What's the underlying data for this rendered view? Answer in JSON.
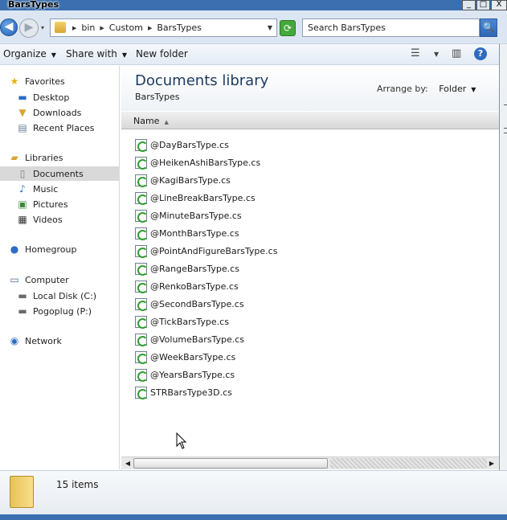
{
  "window": {
    "title": "BarsTypes",
    "minimize": "_",
    "maximize": "□",
    "close": "X"
  },
  "navigation": {
    "back": "◀",
    "forward": "▶",
    "history": "▾",
    "breadcrumb": [
      "bin",
      "Custom",
      "BarsTypes"
    ],
    "refresh": "⟳",
    "search_placeholder": "Search BarsTypes",
    "search_icon": "🔍"
  },
  "toolbar": {
    "organize": "Organize",
    "share_with": "Share with",
    "new_folder": "New folder",
    "view_icon": "☰",
    "preview_icon": "▥",
    "help_icon": "?"
  },
  "sidebar": {
    "favorites": {
      "label": "Favorites",
      "items": [
        "Desktop",
        "Downloads",
        "Recent Places"
      ]
    },
    "libraries": {
      "label": "Libraries",
      "items": [
        "Documents",
        "Music",
        "Pictures",
        "Videos"
      ]
    },
    "homegroup": {
      "label": "Homegroup"
    },
    "computer": {
      "label": "Computer",
      "items": [
        "Local Disk (C:)",
        "Pogoplug (P:)"
      ]
    },
    "network": {
      "label": "Network"
    }
  },
  "content": {
    "library_title": "Documents library",
    "library_subtitle": "BarsTypes",
    "arrange_label": "Arrange by:",
    "arrange_value": "Folder",
    "column_name": "Name",
    "files": [
      "@DayBarsType.cs",
      "@HeikenAshiBarsType.cs",
      "@KagiBarsType.cs",
      "@LineBreakBarsType.cs",
      "@MinuteBarsType.cs",
      "@MonthBarsType.cs",
      "@PointAndFigureBarsType.cs",
      "@RangeBarsType.cs",
      "@RenkoBarsType.cs",
      "@SecondBarsType.cs",
      "@TickBarsType.cs",
      "@VolumeBarsType.cs",
      "@WeekBarsType.cs",
      "@YearsBarsType.cs",
      "STRBarsType3D.cs"
    ]
  },
  "status": {
    "item_count": "15 items"
  }
}
